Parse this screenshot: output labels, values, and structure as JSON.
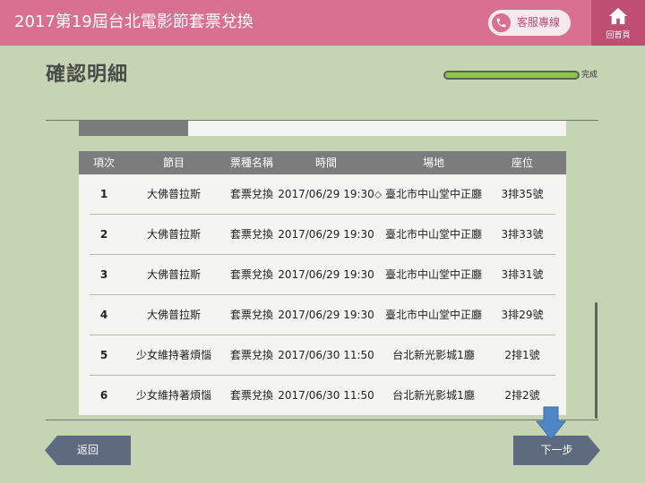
{
  "header": {
    "title": "2017第19屆台北電影節套票兌換",
    "service_label": "客服專線",
    "home_label": "回首頁"
  },
  "page": {
    "title": "確認明細",
    "progress_label": "完成",
    "progress_fraction": 1.0
  },
  "table": {
    "headers": [
      "項次",
      "節目",
      "票種名稱",
      "時間",
      "場地",
      "座位"
    ],
    "rows": [
      {
        "no": "1",
        "program": "大佛普拉斯",
        "ticket": "套票兌換",
        "time": "2017/06/29 19:30",
        "venue": "臺北市中山堂中正廳",
        "seat": "3排35號"
      },
      {
        "no": "2",
        "program": "大佛普拉斯",
        "ticket": "套票兌換",
        "time": "2017/06/29 19:30",
        "venue": "臺北市中山堂中正廳",
        "seat": "3排33號"
      },
      {
        "no": "3",
        "program": "大佛普拉斯",
        "ticket": "套票兌換",
        "time": "2017/06/29 19:30",
        "venue": "臺北市中山堂中正廳",
        "seat": "3排31號"
      },
      {
        "no": "4",
        "program": "大佛普拉斯",
        "ticket": "套票兌換",
        "time": "2017/06/29 19:30",
        "venue": "臺北市中山堂中正廳",
        "seat": "3排29號"
      },
      {
        "no": "5",
        "program": "少女維持著煩惱",
        "ticket": "套票兌換",
        "time": "2017/06/30 11:50",
        "venue": "台北新光影城1廳",
        "seat": "2排1號"
      },
      {
        "no": "6",
        "program": "少女維持著煩惱",
        "ticket": "套票兌換",
        "time": "2017/06/30 11:50",
        "venue": "台北新光影城1廳",
        "seat": "2排2號"
      }
    ]
  },
  "footer": {
    "back_label": "返回",
    "next_label": "下一步"
  },
  "colors": {
    "header": "#d87091",
    "home": "#bf4f72",
    "background": "#c5d4b2",
    "table_header": "#7c7c7c",
    "button": "#5e6a80",
    "progress": "#8fc640",
    "arrow": "#4f86c6"
  },
  "icons": [
    "phone-icon",
    "home-icon",
    "pin-icon",
    "down-arrow-icon"
  ]
}
